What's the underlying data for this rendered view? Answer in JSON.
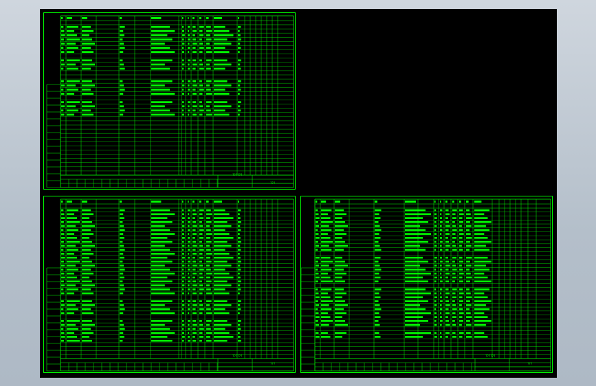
{
  "colors": {
    "background": "#b9c3ce",
    "viewport": "#000000",
    "line": "#00ff00",
    "text": "#00ff00"
  },
  "sheets": [
    {
      "id": "sheet-top-left",
      "title_block_stamp": "??????",
      "page_label": "???",
      "header_cells": [
        "??",
        "? ?",
        "?",
        "?",
        "?",
        "? ? ? ?",
        "? ?",
        "? ?",
        "? ? ? ?"
      ],
      "row_count": 36
    },
    {
      "id": "sheet-bottom-left",
      "title_block_stamp": "??????",
      "page_label": "???",
      "header_cells": [
        "??",
        "? ?",
        "?",
        "?",
        "?",
        "? ? ? ?",
        "? ?",
        "? ?",
        "? ? ? ?"
      ],
      "row_count": 38
    },
    {
      "id": "sheet-bottom-right",
      "title_block_stamp": "??????",
      "page_label": "???",
      "header_cells": [
        "??",
        "? ?",
        "?",
        "?",
        "?",
        "? ? ? ?",
        "? ?",
        "? ?",
        "? ? ? ?",
        "? ?"
      ],
      "row_count": 38
    }
  ]
}
